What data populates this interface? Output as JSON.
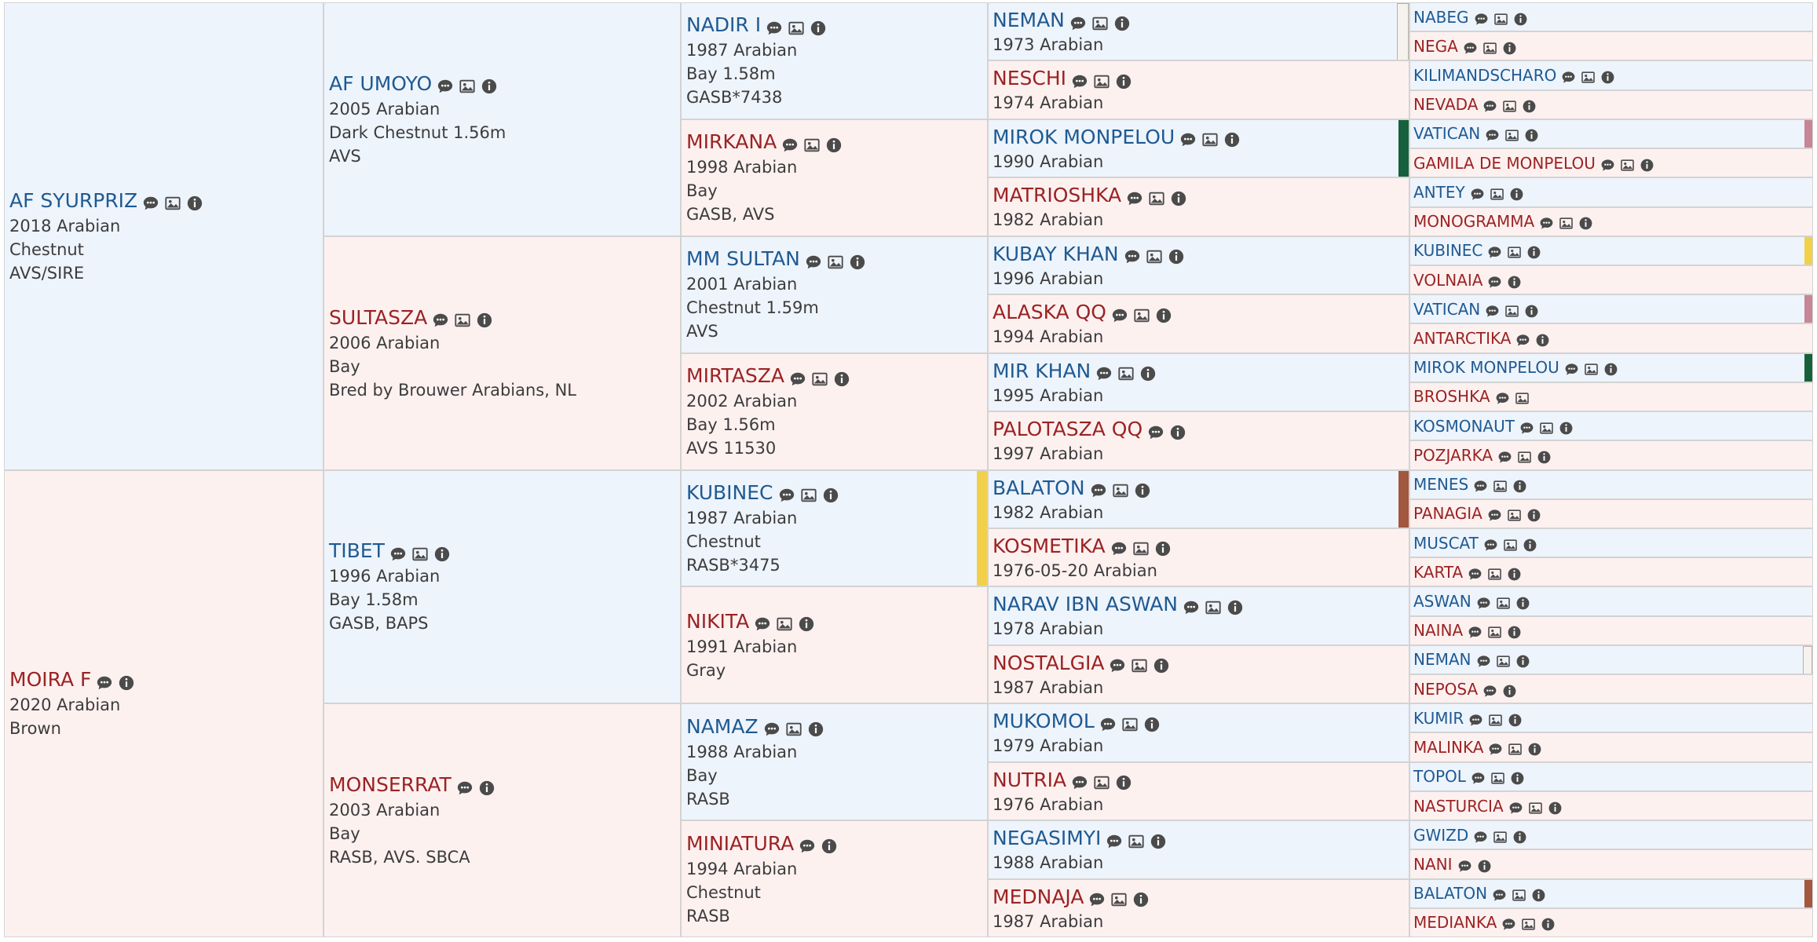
{
  "icons": {
    "comment": "comment-icon",
    "image": "image-icon",
    "info": "info-icon"
  },
  "pedigree": {
    "subject": [
      {
        "name": "AF SYURPRIZ",
        "sex": "m",
        "lines": [
          "2018 Arabian",
          "Chestnut",
          "AVS/SIRE"
        ],
        "icons": [
          "comment",
          "image",
          "info"
        ]
      },
      {
        "name": "MOIRA F",
        "sex": "f",
        "lines": [
          "2020 Arabian",
          "Brown"
        ],
        "icons": [
          "comment",
          "info"
        ]
      }
    ],
    "parents": [
      {
        "name": "AF UMOYO",
        "sex": "m",
        "lines": [
          "2005 Arabian",
          "Dark Chestnut 1.56m",
          "AVS"
        ],
        "icons": [
          "comment",
          "image",
          "info"
        ]
      },
      {
        "name": "SULTASZA",
        "sex": "f",
        "lines": [
          "2006 Arabian",
          "Bay",
          "Bred by Brouwer Arabians, NL"
        ],
        "icons": [
          "comment",
          "image",
          "info"
        ]
      },
      {
        "name": "TIBET",
        "sex": "m",
        "lines": [
          "1996 Arabian",
          "Bay 1.58m",
          "GASB, BAPS"
        ],
        "icons": [
          "comment",
          "image",
          "info"
        ]
      },
      {
        "name": "MONSERRAT",
        "sex": "f",
        "lines": [
          "2003 Arabian",
          "Bay",
          "RASB, AVS. SBCA"
        ],
        "icons": [
          "comment",
          "info"
        ]
      }
    ],
    "grandparents": [
      {
        "name": "NADIR I",
        "sex": "m",
        "lines": [
          "1987 Arabian",
          "Bay 1.58m",
          "GASB*7438"
        ],
        "icons": [
          "comment",
          "image",
          "info"
        ]
      },
      {
        "name": "MIRKANA",
        "sex": "f",
        "lines": [
          "1998 Arabian",
          "Bay",
          "GASB, AVS"
        ],
        "icons": [
          "comment",
          "image",
          "info"
        ]
      },
      {
        "name": "MM SULTAN",
        "sex": "m",
        "lines": [
          "2001 Arabian",
          "Chestnut 1.59m",
          "AVS"
        ],
        "icons": [
          "comment",
          "image",
          "info"
        ]
      },
      {
        "name": "MIRTASZA",
        "sex": "f",
        "lines": [
          "2002 Arabian",
          "Bay 1.56m",
          "AVS 11530"
        ],
        "icons": [
          "comment",
          "image",
          "info"
        ]
      },
      {
        "name": "KUBINEC",
        "sex": "m",
        "lines": [
          "1987 Arabian",
          "Chestnut",
          "RASB*3475"
        ],
        "icons": [
          "comment",
          "image",
          "info"
        ],
        "bar": "#f2d04a"
      },
      {
        "name": "NIKITA",
        "sex": "f",
        "lines": [
          "1991 Arabian",
          "Gray"
        ],
        "icons": [
          "comment",
          "image",
          "info"
        ]
      },
      {
        "name": "NAMAZ",
        "sex": "m",
        "lines": [
          "1988 Arabian",
          "Bay",
          "RASB"
        ],
        "icons": [
          "comment",
          "image",
          "info"
        ]
      },
      {
        "name": "MINIATURA",
        "sex": "f",
        "lines": [
          "1994 Arabian",
          "Chestnut",
          "RASB"
        ],
        "icons": [
          "comment",
          "info"
        ]
      }
    ],
    "great_grandparents": [
      {
        "name": "NEMAN",
        "sex": "m",
        "lines": [
          "1973 Arabian"
        ],
        "icons": [
          "comment",
          "image",
          "info"
        ],
        "bar": "#f6f3ee"
      },
      {
        "name": "NESCHI",
        "sex": "f",
        "lines": [
          "1974 Arabian"
        ],
        "icons": [
          "comment",
          "image",
          "info"
        ]
      },
      {
        "name": "MIROK MONPELOU",
        "sex": "m",
        "lines": [
          "1990 Arabian"
        ],
        "icons": [
          "comment",
          "image",
          "info"
        ],
        "bar": "#17603c"
      },
      {
        "name": "MATRIOSHKA",
        "sex": "f",
        "lines": [
          "1982 Arabian"
        ],
        "icons": [
          "comment",
          "image",
          "info"
        ]
      },
      {
        "name": "KUBAY KHAN",
        "sex": "m",
        "lines": [
          "1996 Arabian"
        ],
        "icons": [
          "comment",
          "image",
          "info"
        ]
      },
      {
        "name": "ALASKA QQ",
        "sex": "f",
        "lines": [
          "1994 Arabian"
        ],
        "icons": [
          "comment",
          "image",
          "info"
        ]
      },
      {
        "name": "MIR KHAN",
        "sex": "m",
        "lines": [
          "1995 Arabian"
        ],
        "icons": [
          "comment",
          "image",
          "info"
        ]
      },
      {
        "name": "PALOTASZA QQ",
        "sex": "f",
        "lines": [
          "1997 Arabian"
        ],
        "icons": [
          "comment",
          "info"
        ]
      },
      {
        "name": "BALATON",
        "sex": "m",
        "lines": [
          "1982 Arabian"
        ],
        "icons": [
          "comment",
          "image",
          "info"
        ],
        "bar": "#a2573f"
      },
      {
        "name": "KOSMETIKA",
        "sex": "f",
        "lines": [
          "1976-05-20 Arabian"
        ],
        "icons": [
          "comment",
          "image",
          "info"
        ]
      },
      {
        "name": "NARAV IBN ASWAN",
        "sex": "m",
        "lines": [
          "1978 Arabian"
        ],
        "icons": [
          "comment",
          "image",
          "info"
        ]
      },
      {
        "name": "NOSTALGIA",
        "sex": "f",
        "lines": [
          "1987 Arabian"
        ],
        "icons": [
          "comment",
          "image",
          "info"
        ]
      },
      {
        "name": "MUKOMOL",
        "sex": "m",
        "lines": [
          "1979 Arabian"
        ],
        "icons": [
          "comment",
          "image",
          "info"
        ]
      },
      {
        "name": "NUTRIA",
        "sex": "f",
        "lines": [
          "1976 Arabian"
        ],
        "icons": [
          "comment",
          "image",
          "info"
        ]
      },
      {
        "name": "NEGASIMYI",
        "sex": "m",
        "lines": [
          "1988 Arabian"
        ],
        "icons": [
          "comment",
          "image",
          "info"
        ]
      },
      {
        "name": "MEDNAJA",
        "sex": "f",
        "lines": [
          "1987 Arabian"
        ],
        "icons": [
          "comment",
          "image",
          "info"
        ]
      }
    ],
    "gen5": [
      {
        "name": "NABEG",
        "sex": "m",
        "icons": [
          "comment",
          "image",
          "info"
        ]
      },
      {
        "name": "NEGA",
        "sex": "f",
        "icons": [
          "comment",
          "image",
          "info"
        ]
      },
      {
        "name": "KILIMANDSCHARO",
        "sex": "m",
        "icons": [
          "comment",
          "image",
          "info"
        ]
      },
      {
        "name": "NEVADA",
        "sex": "f",
        "icons": [
          "comment",
          "image",
          "info"
        ]
      },
      {
        "name": "VATICAN",
        "sex": "m",
        "icons": [
          "comment",
          "image",
          "info"
        ],
        "bar": "#c78695"
      },
      {
        "name": "GAMILA DE MONPELOU",
        "sex": "f",
        "icons": [
          "comment",
          "image",
          "info"
        ]
      },
      {
        "name": "ANTEY",
        "sex": "m",
        "icons": [
          "comment",
          "image",
          "info"
        ]
      },
      {
        "name": "MONOGRAMMA",
        "sex": "f",
        "icons": [
          "comment",
          "image",
          "info"
        ]
      },
      {
        "name": "KUBINEC",
        "sex": "m",
        "icons": [
          "comment",
          "image",
          "info"
        ],
        "bar": "#f2d04a"
      },
      {
        "name": "VOLNAIA",
        "sex": "f",
        "icons": [
          "comment",
          "info"
        ]
      },
      {
        "name": "VATICAN",
        "sex": "m",
        "icons": [
          "comment",
          "image",
          "info"
        ],
        "bar": "#c78695"
      },
      {
        "name": "ANTARCTIKA",
        "sex": "f",
        "icons": [
          "comment",
          "info"
        ]
      },
      {
        "name": "MIROK MONPELOU",
        "sex": "m",
        "icons": [
          "comment",
          "image",
          "info"
        ],
        "bar": "#17603c"
      },
      {
        "name": "BROSHKA",
        "sex": "f",
        "icons": [
          "comment",
          "image"
        ]
      },
      {
        "name": "KOSMONAUT",
        "sex": "m",
        "icons": [
          "comment",
          "image",
          "info"
        ]
      },
      {
        "name": "POZJARKA",
        "sex": "f",
        "icons": [
          "comment",
          "image",
          "info"
        ]
      },
      {
        "name": "MENES",
        "sex": "m",
        "icons": [
          "comment",
          "image",
          "info"
        ]
      },
      {
        "name": "PANAGIA",
        "sex": "f",
        "icons": [
          "comment",
          "image",
          "info"
        ]
      },
      {
        "name": "MUSCAT",
        "sex": "m",
        "icons": [
          "comment",
          "image",
          "info"
        ]
      },
      {
        "name": "KARTA",
        "sex": "f",
        "icons": [
          "comment",
          "image",
          "info"
        ]
      },
      {
        "name": "ASWAN",
        "sex": "m",
        "icons": [
          "comment",
          "image",
          "info"
        ]
      },
      {
        "name": "NAINA",
        "sex": "f",
        "icons": [
          "comment",
          "image",
          "info"
        ]
      },
      {
        "name": "NEMAN",
        "sex": "m",
        "icons": [
          "comment",
          "image",
          "info"
        ],
        "bar": "#f6f3ee"
      },
      {
        "name": "NEPOSA",
        "sex": "f",
        "icons": [
          "comment",
          "info"
        ]
      },
      {
        "name": "KUMIR",
        "sex": "m",
        "icons": [
          "comment",
          "image",
          "info"
        ]
      },
      {
        "name": "MALINKA",
        "sex": "f",
        "icons": [
          "comment",
          "image",
          "info"
        ]
      },
      {
        "name": "TOPOL",
        "sex": "m",
        "icons": [
          "comment",
          "image",
          "info"
        ]
      },
      {
        "name": "NASTURCIA",
        "sex": "f",
        "icons": [
          "comment",
          "image",
          "info"
        ]
      },
      {
        "name": "GWIZD",
        "sex": "m",
        "icons": [
          "comment",
          "image",
          "info"
        ]
      },
      {
        "name": "NANI",
        "sex": "f",
        "icons": [
          "comment",
          "info"
        ]
      },
      {
        "name": "BALATON",
        "sex": "m",
        "icons": [
          "comment",
          "image",
          "info"
        ],
        "bar": "#a2573f"
      },
      {
        "name": "MEDIANKA",
        "sex": "f",
        "icons": [
          "comment",
          "image",
          "info"
        ]
      }
    ]
  }
}
